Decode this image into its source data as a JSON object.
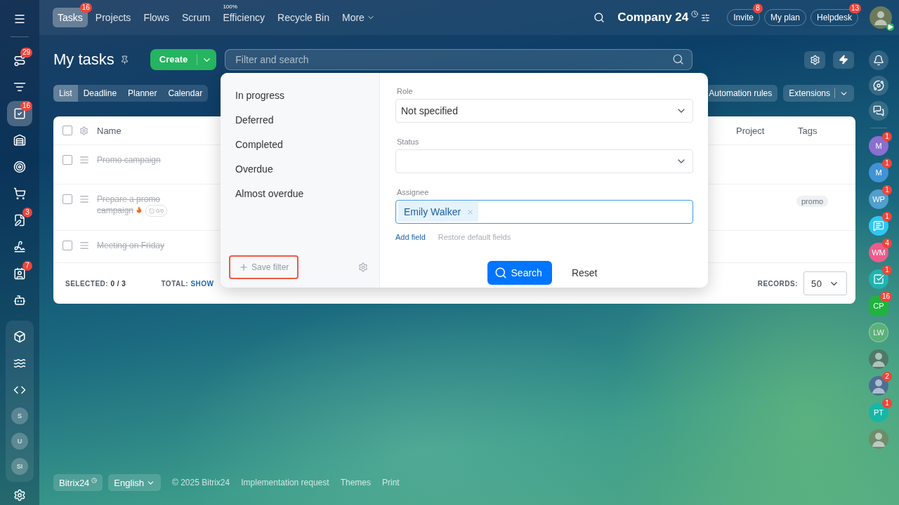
{
  "left_sidebar": {
    "items": [
      {
        "kind": "route",
        "counter": "29",
        "selected": false
      },
      {
        "kind": "funnel",
        "selected": false
      },
      {
        "kind": "tasks",
        "counter": "16",
        "selected": true
      },
      {
        "kind": "warehouse",
        "selected": false
      },
      {
        "kind": "target",
        "selected": false
      },
      {
        "kind": "cart",
        "selected": false
      },
      {
        "kind": "document",
        "counter": "3",
        "selected": false
      },
      {
        "kind": "signature",
        "selected": false
      },
      {
        "kind": "contact",
        "counter": "7",
        "selected": false
      },
      {
        "kind": "robot",
        "selected": false
      }
    ],
    "apps": [
      {
        "kind": "box"
      },
      {
        "kind": "waves"
      },
      {
        "kind": "code"
      },
      {
        "kind": "initials",
        "initials": "S"
      },
      {
        "kind": "initials",
        "initials": "U"
      },
      {
        "kind": "initials",
        "initials": "SI"
      }
    ]
  },
  "topbar": {
    "tabs": [
      {
        "label": "Tasks",
        "selected": true,
        "counter": "16"
      },
      {
        "label": "Projects",
        "selected": false
      },
      {
        "label": "Flows",
        "selected": false
      },
      {
        "label": "Scrum",
        "selected": false
      },
      {
        "label": "Efficiency",
        "selected": false,
        "note": "100%"
      },
      {
        "label": "Recycle Bin",
        "selected": false
      },
      {
        "label": "More",
        "selected": false,
        "kind": "menu"
      }
    ],
    "company": "Company 24",
    "buttons": [
      {
        "label": "Invite",
        "counter": "8"
      },
      {
        "label": "My plan"
      },
      {
        "label": "Helpdesk",
        "counter": "13"
      }
    ]
  },
  "header": {
    "title": "My tasks",
    "create": "Create",
    "search": {
      "placeholder": "Filter and search"
    }
  },
  "views": [
    {
      "label": "List",
      "selected": true
    },
    {
      "label": "Deadline",
      "selected": false
    },
    {
      "label": "Planner",
      "selected": false
    },
    {
      "label": "Calendar",
      "selected": false
    }
  ],
  "view_actions": [
    {
      "label": "Automation rules",
      "kind": "plain"
    },
    {
      "label": "Extensions",
      "kind": "split"
    }
  ],
  "table": {
    "columns": [
      "Name",
      "Project",
      "Tags"
    ],
    "rows": [
      {
        "name": "Promo campaign",
        "completed": true,
        "checked": false
      },
      {
        "name": "Prepare a promo campaign",
        "completed": true,
        "checked": false,
        "hot": true,
        "checklist": "0/6",
        "tags": [
          "promo"
        ]
      },
      {
        "name": "Meeting on Friday",
        "completed": true,
        "checked": false
      }
    ],
    "header_checked": false,
    "selected_label": "SELECTED:",
    "selected_value": "0 / 3",
    "total_label": "TOTAL:",
    "total_link": "SHOW",
    "records_label": "RECORDS:",
    "records_value": "50"
  },
  "filter_popup": {
    "presets": [
      "In progress",
      "Deferred",
      "Completed",
      "Overdue",
      "Almost overdue"
    ],
    "save_filter": {
      "label": "Save filter",
      "highlighted": true
    },
    "fields": [
      {
        "label": "Role",
        "kind": "select",
        "value": "Not specified"
      },
      {
        "label": "Status",
        "kind": "select"
      },
      {
        "label": "Assignee",
        "kind": "tags",
        "tags": [
          "Emily Walker"
        ],
        "focused": true
      }
    ],
    "add_field": "Add field",
    "restore": "Restore default fields",
    "search": "Search",
    "reset": "Reset"
  },
  "right_rail": {
    "tools": [
      {
        "kind": "bell"
      },
      {
        "kind": "copilot"
      },
      {
        "kind": "chat"
      }
    ],
    "contacts": [
      {
        "kind": "initials",
        "initials": "M",
        "color": "#8a6fd1",
        "counter": "1"
      },
      {
        "kind": "initials",
        "initials": "M",
        "color": "#3f93d6",
        "counter": "1"
      },
      {
        "kind": "initials",
        "initials": "WP",
        "color": "#4f9fcf",
        "counter": "1"
      },
      {
        "kind": "chat",
        "color": "#2fc6f6",
        "counter": "1"
      },
      {
        "kind": "initials",
        "initials": "WM",
        "color": "#ef5b8a",
        "counter": "4"
      },
      {
        "kind": "check",
        "color": "#1fb3b0",
        "counter": "1"
      },
      {
        "kind": "hexagon",
        "initials": "CP",
        "color": "#21b33f",
        "counter": "16"
      },
      {
        "kind": "initials",
        "initials": "LW",
        "color": "#5cb07a",
        "inactive": true
      },
      {
        "kind": "photo",
        "color": "#4f7a68"
      },
      {
        "kind": "photo",
        "color": "#4d6f94",
        "counter": "2"
      },
      {
        "kind": "initials",
        "initials": "PT",
        "color": "#16b7a7",
        "counter": "1"
      },
      {
        "kind": "photo",
        "color": "#6d8d6a"
      }
    ]
  },
  "footer": {
    "brand": "Bitrix24",
    "language": "English",
    "copyright": "© 2025 Bitrix24",
    "links": [
      "Implementation request",
      "Themes",
      "Print"
    ]
  }
}
